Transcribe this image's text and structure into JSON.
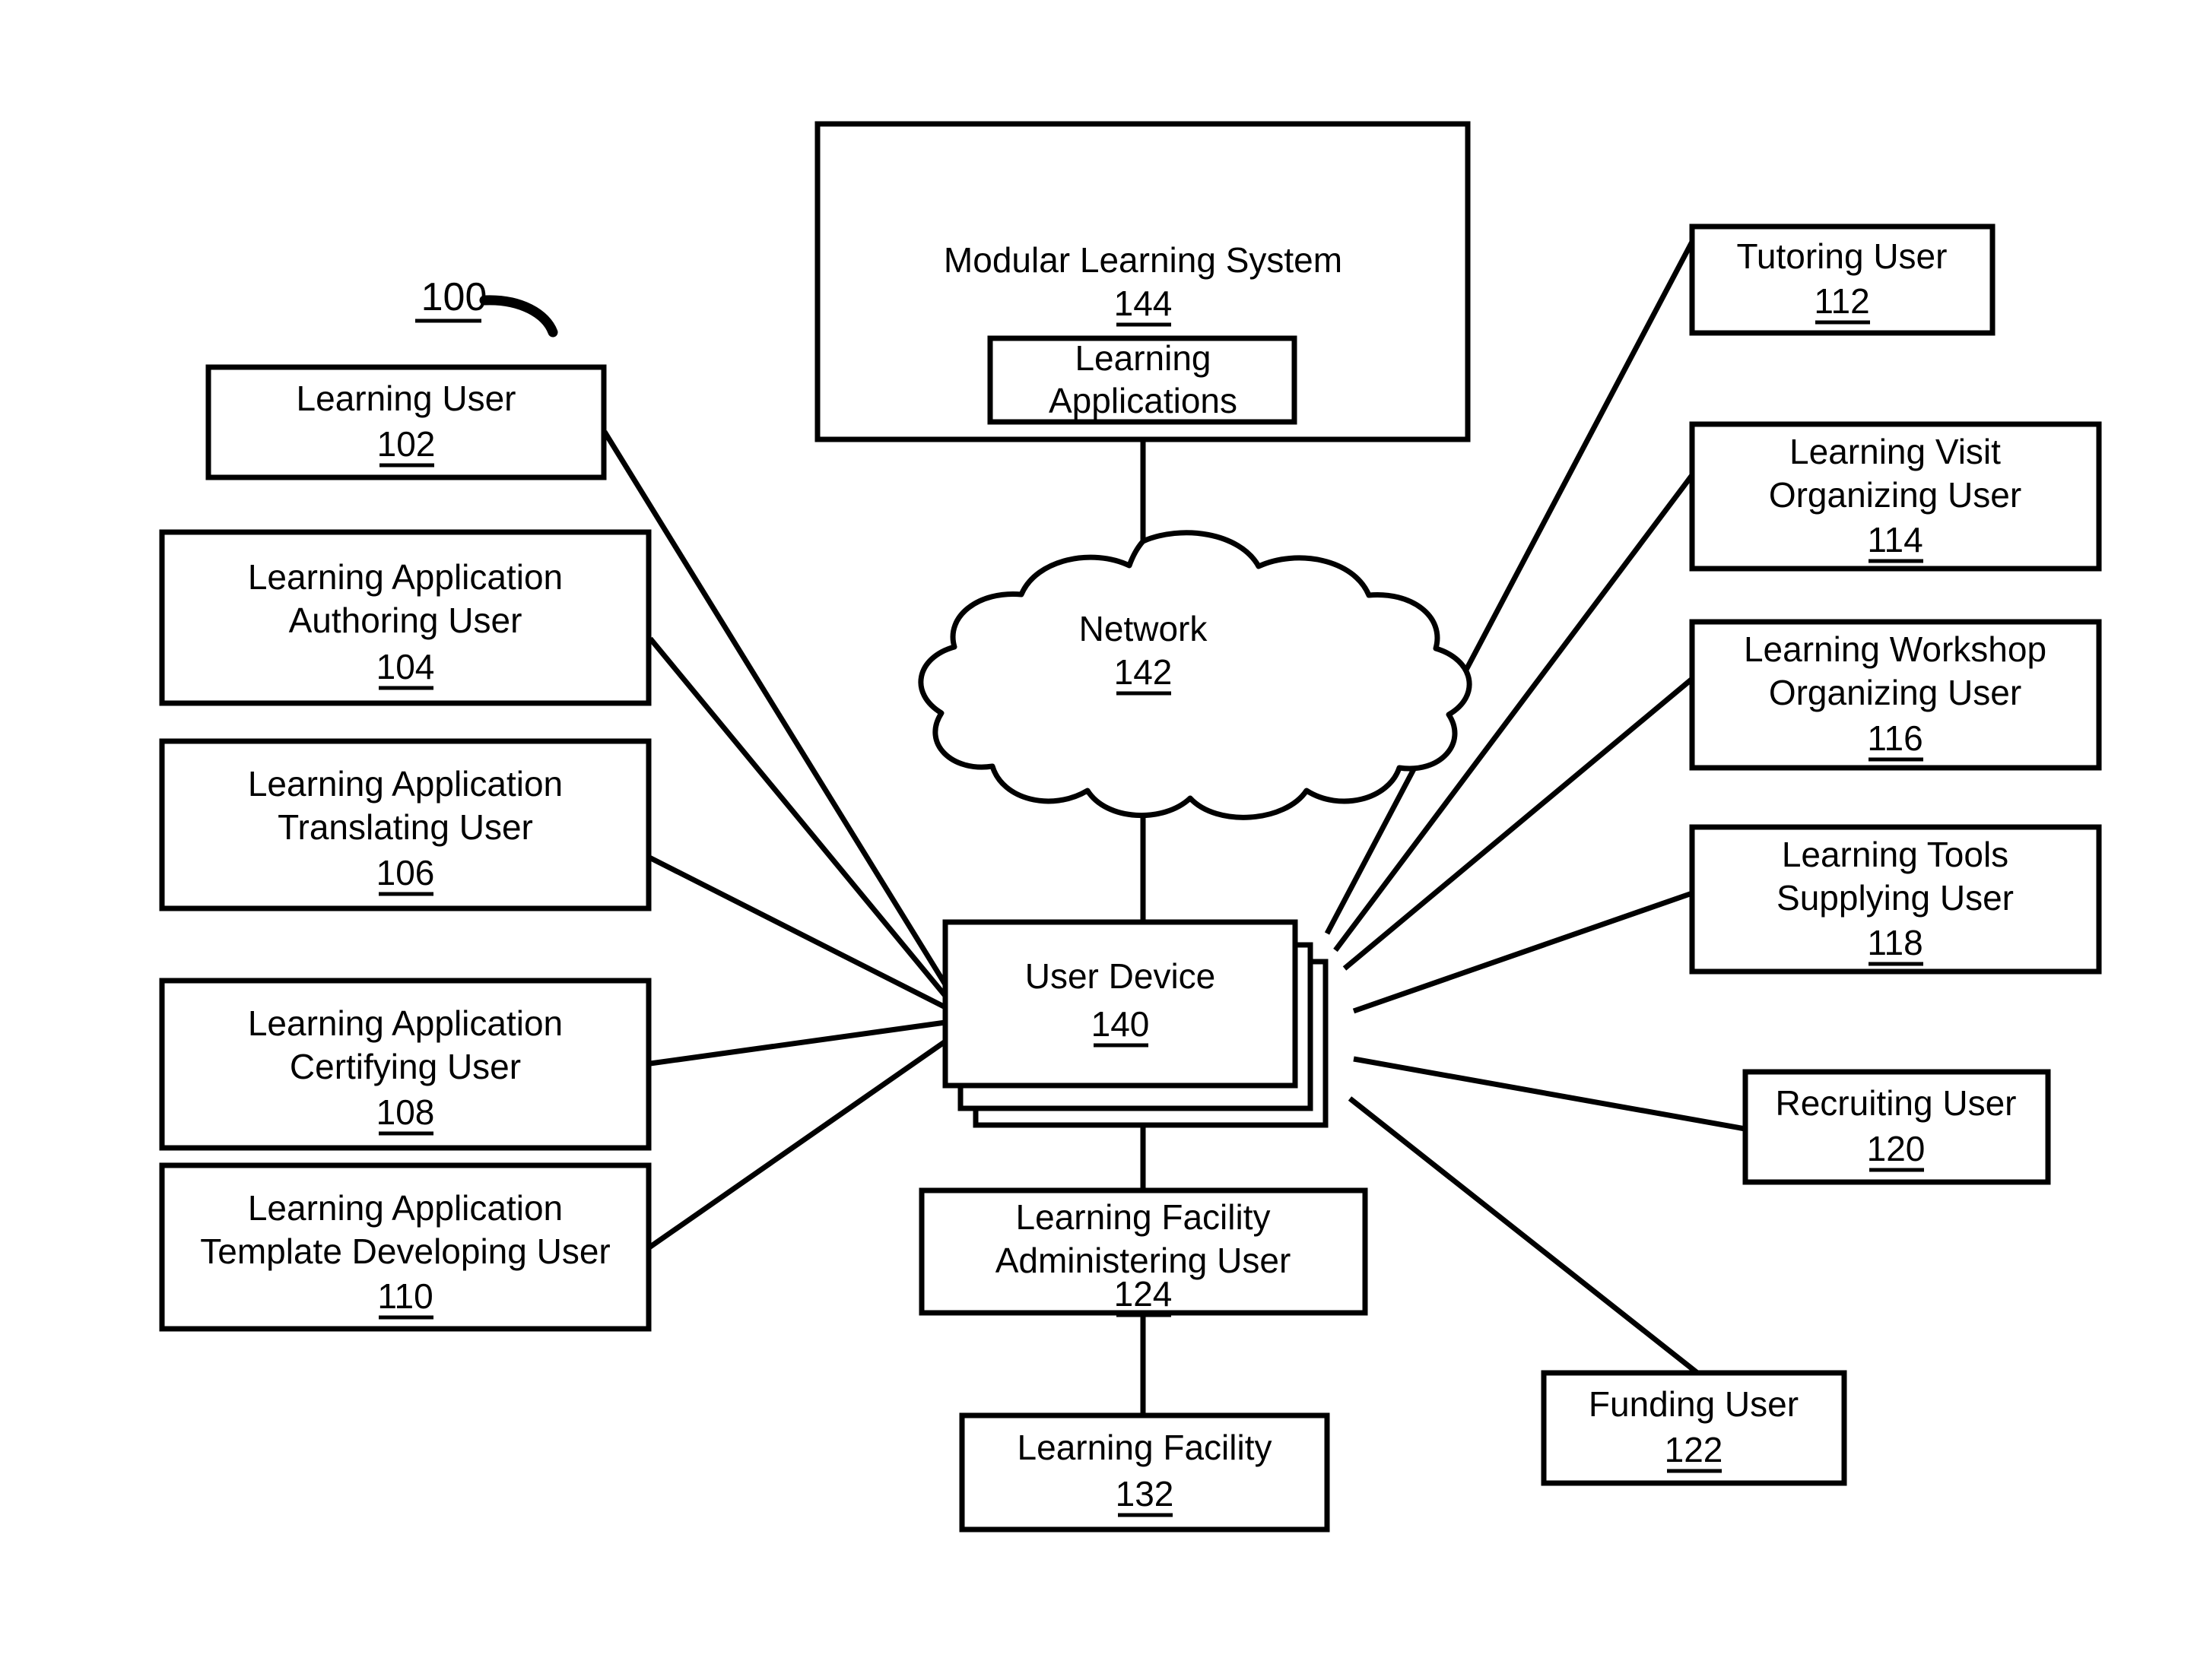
{
  "figure": {
    "id_label": "100",
    "background_color": "#ffffff",
    "line_color": "#000000"
  },
  "nodes": {
    "modular_learning_system": {
      "title": "Modular Learning System",
      "ref": "144"
    },
    "learning_applications": {
      "title_line1": "Learning",
      "title_line2": "Applications"
    },
    "network": {
      "title": "Network",
      "ref": "142"
    },
    "user_device": {
      "title": "User Device",
      "ref": "140"
    },
    "learning_user": {
      "title": "Learning User",
      "ref": "102"
    },
    "authoring_user": {
      "line1": "Learning Application",
      "line2": "Authoring User",
      "ref": "104"
    },
    "translating_user": {
      "line1": "Learning Application",
      "line2": "Translating User",
      "ref": "106"
    },
    "certifying_user": {
      "line1": "Learning Application",
      "line2": "Certifying User",
      "ref": "108"
    },
    "template_developing_user": {
      "line1": "Learning Application",
      "line2": "Template Developing User",
      "ref": "110"
    },
    "tutoring_user": {
      "title": "Tutoring User",
      "ref": "112"
    },
    "visit_organizing_user": {
      "line1": "Learning Visit",
      "line2": "Organizing User",
      "ref": "114"
    },
    "workshop_organizing_user": {
      "line1": "Learning Workshop",
      "line2": "Organizing User",
      "ref": "116"
    },
    "tools_supplying_user": {
      "line1": "Learning Tools",
      "line2": "Supplying User",
      "ref": "118"
    },
    "recruiting_user": {
      "title": "Recruiting User",
      "ref": "120"
    },
    "funding_user": {
      "title": "Funding User",
      "ref": "122"
    },
    "facility_administering_user": {
      "line1": "Learning Facility",
      "line2": "Administering User",
      "ref": "124"
    },
    "learning_facility": {
      "title": "Learning Facility",
      "ref": "132"
    }
  }
}
